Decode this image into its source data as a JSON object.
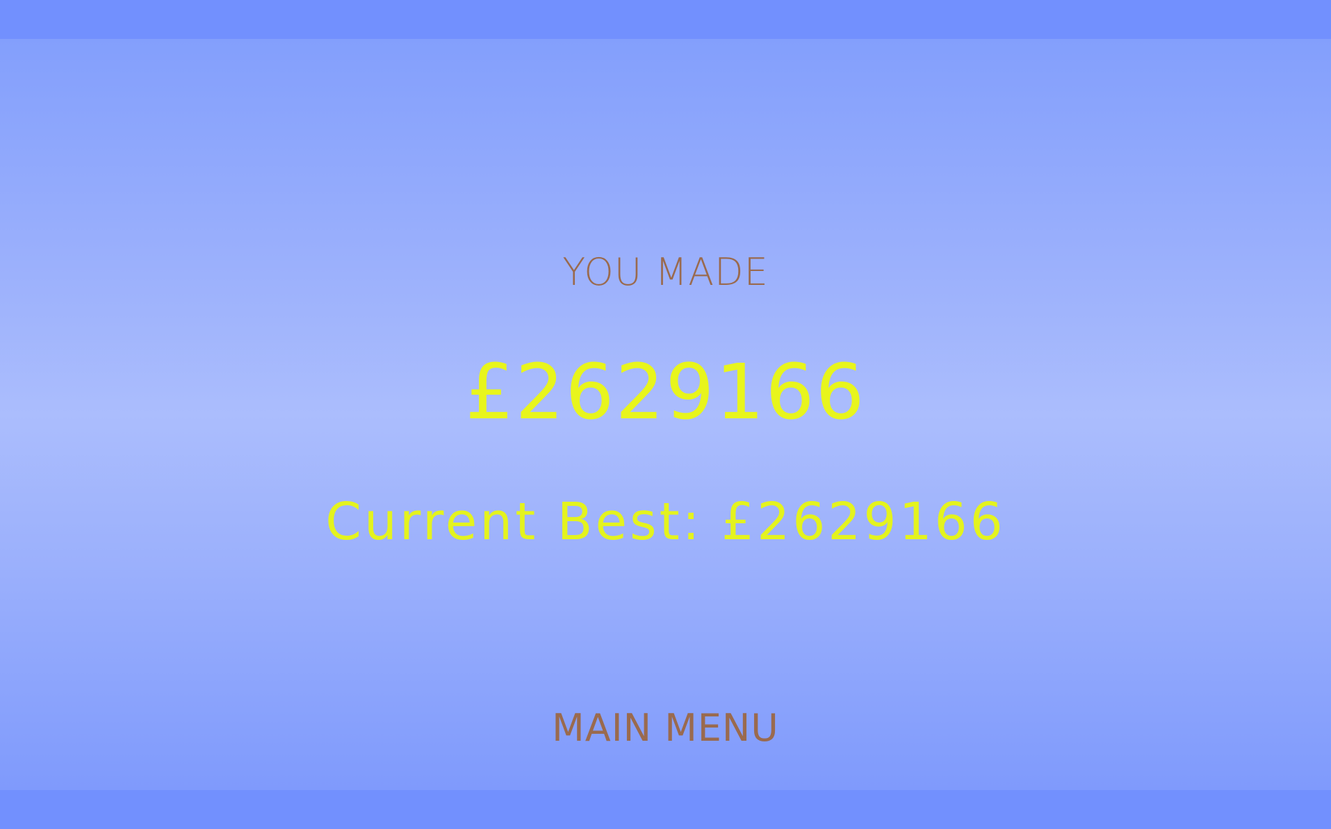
{
  "result": {
    "heading": "YOU MADE",
    "amount": "£2629166",
    "best_text": "Current Best: £2629166"
  },
  "menu": {
    "main_menu_label": "MAIN MENU"
  },
  "colors": {
    "background": "#7290fe",
    "accent_yellow": "#e8f51c",
    "text_brown": "#9a6a4e"
  }
}
